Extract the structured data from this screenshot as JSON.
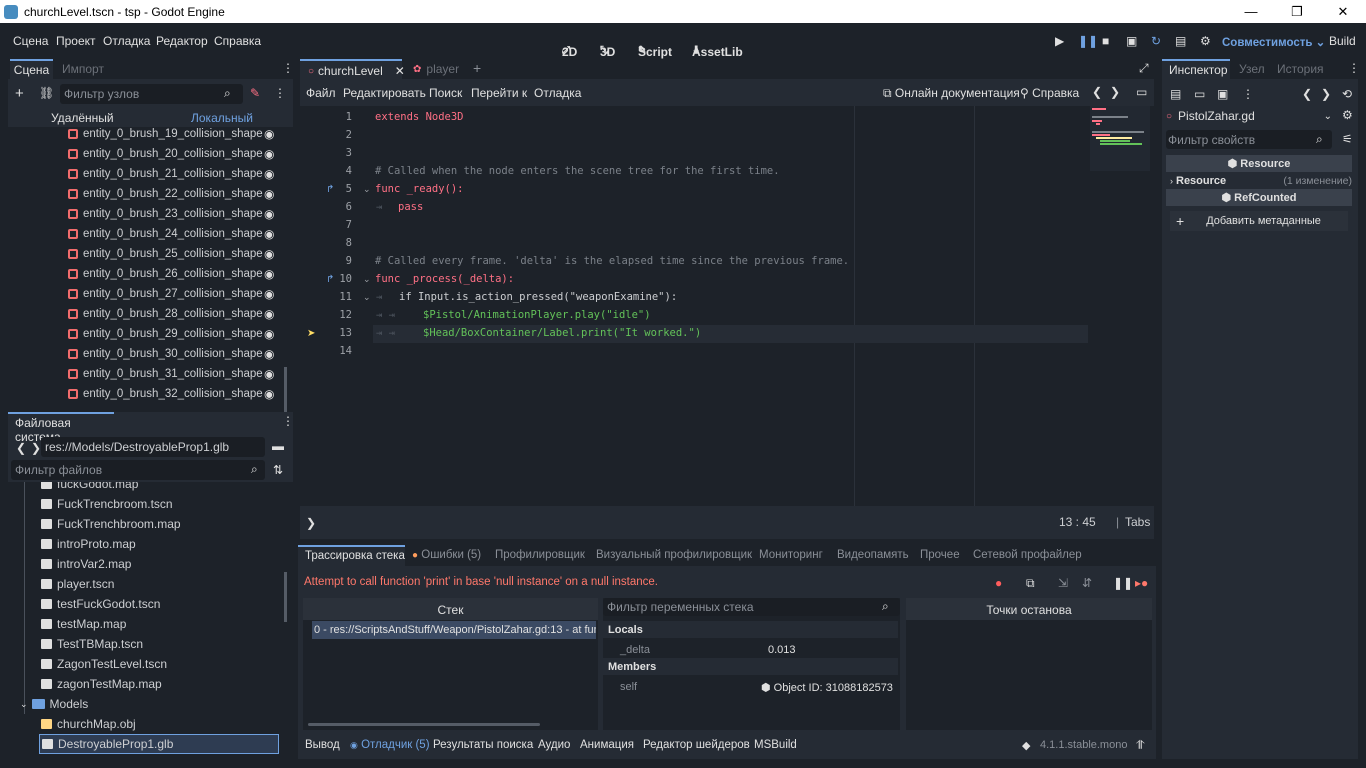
{
  "window": {
    "title": "churchLevel.tscn - tsp - Godot Engine",
    "minimize": "—",
    "maximize": "❐",
    "close": "✕"
  },
  "menu": [
    "Сцена",
    "Проект",
    "Отладка",
    "Редактор",
    "Справка"
  ],
  "main_screens": {
    "2d": "2D",
    "3d": "3D",
    "script": "Script",
    "assetlib": "AssetLib"
  },
  "top_right": {
    "renderer": "Совместимость",
    "build": "Build"
  },
  "scene_dock": {
    "tabs": [
      "Сцена",
      "Импорт"
    ],
    "filter_placeholder": "Фильтр узлов",
    "remote": "Удалённый",
    "local": "Локальный",
    "nodes": [
      "entity_0_brush_19_collision_shape",
      "entity_0_brush_20_collision_shape",
      "entity_0_brush_21_collision_shape",
      "entity_0_brush_22_collision_shape",
      "entity_0_brush_23_collision_shape",
      "entity_0_brush_24_collision_shape",
      "entity_0_brush_25_collision_shape",
      "entity_0_brush_26_collision_shape",
      "entity_0_brush_27_collision_shape",
      "entity_0_brush_28_collision_shape",
      "entity_0_brush_29_collision_shape",
      "entity_0_brush_30_collision_shape",
      "entity_0_brush_31_collision_shape",
      "entity_0_brush_32_collision_shape"
    ]
  },
  "filesystem": {
    "title": "Файловая система",
    "path": "res://Models/DestroyableProp1.glb",
    "filter_placeholder": "Фильтр файлов",
    "files": [
      "fuckGodot.map",
      "FuckTrencbroom.tscn",
      "FuckTrenchbroom.map",
      "introProto.map",
      "introVar2.map",
      "player.tscn",
      "testFuckGodot.tscn",
      "testMap.map",
      "TestTBMap.tscn",
      "ZagonTestLevel.tscn",
      "zagonTestMap.map"
    ],
    "folder": "Models",
    "model_files": [
      "churchMap.obj",
      "DestroyableProp1.glb"
    ]
  },
  "editor": {
    "tabs": [
      "churchLevel",
      "player"
    ],
    "script_menu": [
      "Файл",
      "Редактировать",
      "Поиск",
      "Перейти к",
      "Отладка"
    ],
    "online_docs": "Онлайн документация",
    "help": "Справка",
    "lines": [
      {
        "n": "1",
        "t": "extends Node3D"
      },
      {
        "n": "2",
        "t": ""
      },
      {
        "n": "3",
        "t": ""
      },
      {
        "n": "4",
        "t": "# Called when the node enters the scene tree for the first time."
      },
      {
        "n": "5",
        "t": "func _ready():"
      },
      {
        "n": "6",
        "t": "pass"
      },
      {
        "n": "7",
        "t": ""
      },
      {
        "n": "8",
        "t": ""
      },
      {
        "n": "9",
        "t": "# Called every frame. 'delta' is the elapsed time since the previous frame."
      },
      {
        "n": "10",
        "t": "func _process(_delta):"
      },
      {
        "n": "11",
        "t": "if Input.is_action_pressed(\"weaponExamine\"):"
      },
      {
        "n": "12",
        "t": "$Pistol/AnimationPlayer.play(\"idle\")"
      },
      {
        "n": "13",
        "t": "$Head/BoxContainer/Label.print(\"It worked.\")"
      },
      {
        "n": "14",
        "t": ""
      }
    ],
    "cursor": "13  :  45",
    "indent": "Tabs"
  },
  "debugger": {
    "tabs": [
      "Трассировка стека",
      "Ошибки (5)",
      "Профилировщик",
      "Визуальный профилировщик",
      "Мониторинг",
      "Видеопамять",
      "Прочее",
      "Сетевой профайлер"
    ],
    "error": "Attempt to call function 'print' in base 'null instance' on a null instance.",
    "stack_header": "Стек",
    "stack_entry": "0 - res://ScriptsAndStuff/Weapon/PistolZahar.gd:13 - at funct",
    "var_filter_placeholder": "Фильтр переменных стека",
    "locals": "Locals",
    "delta_name": "_delta",
    "delta_value": "0.013",
    "members": "Members",
    "self_name": "self",
    "self_value": "Object ID: 31088182573",
    "breakpoints": "Точки останова"
  },
  "bottom_bar": {
    "tabs": [
      "Вывод",
      "Отладчик (5)",
      "Результаты поиска",
      "Аудио",
      "Анимация",
      "Редактор шейдеров",
      "MSBuild"
    ],
    "version": "4.1.1.stable.mono"
  },
  "inspector": {
    "tabs": [
      "Инспектор",
      "Узел",
      "История"
    ],
    "resource": "PistolZahar.gd",
    "filter_placeholder": "Фильтр свойств",
    "section1": "Resource",
    "group": "Resource",
    "changes": "(1 изменение)",
    "section2": "RefCounted",
    "add_metadata": "Добавить метаданные"
  },
  "colors": {
    "accent": "#6fa1e0",
    "error": "#ff786b",
    "bg": "#252b34",
    "dark": "#1d2229"
  }
}
